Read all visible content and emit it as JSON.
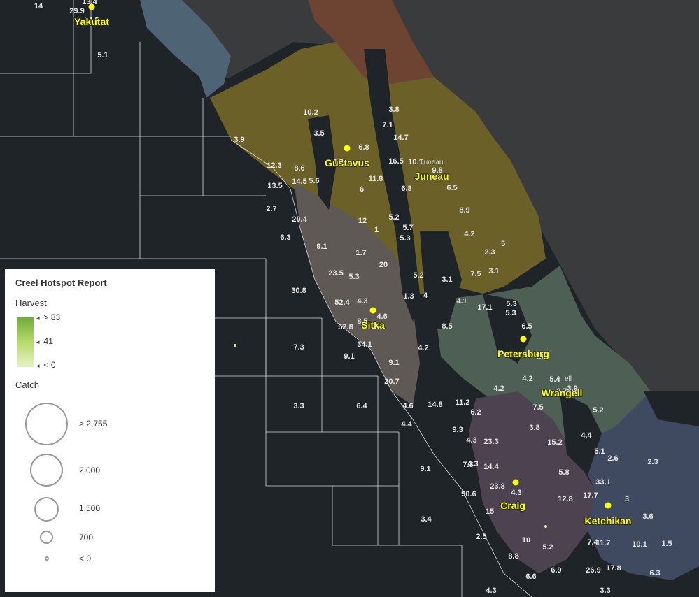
{
  "map": {
    "cities": [
      {
        "name": "Yakutat"
      },
      {
        "name": "Gustavus"
      },
      {
        "name": "Juneau"
      },
      {
        "name": "Sitka"
      },
      {
        "name": "Petersburg"
      },
      {
        "name": "Wrangell"
      },
      {
        "name": "Craig"
      },
      {
        "name": "Ketchikan"
      }
    ],
    "small_labels": [
      "Juneau",
      "ell"
    ],
    "area_values": [
      "14",
      "13.4",
      "29.9",
      "14.9",
      "5.1",
      "10.2",
      "3.5",
      "6.8",
      "14.3",
      "3.9",
      "12.3",
      "8.6",
      "13.5",
      "14.5",
      "5.6",
      "2.7",
      "20.4",
      "6.3",
      "9.1",
      "1.7",
      "23.5",
      "5.3",
      "30.8",
      "52.4",
      "4.3",
      "4.6",
      "8.5",
      "52.8",
      "34.1",
      "9.1",
      "9.1",
      "20.7",
      "7.3",
      "3.3",
      "6.4",
      "4.6",
      "4.4",
      "9.1",
      "3.4",
      "3.8",
      "7.1",
      "14.7",
      "16.5",
      "10.1",
      "9.8",
      "11.8",
      "6.8",
      "6.5",
      "6",
      "12",
      "5.2",
      "5.7",
      "1",
      "5.3",
      "8.9",
      "4.2",
      "20",
      "2.3",
      "5",
      "5.2",
      "3.1",
      "7.5",
      "1.3",
      "4",
      "3.1",
      "4.1",
      "17.1",
      "5.3",
      "5.3",
      "8.5",
      "6.5",
      "4.6",
      "4.2",
      "4.2",
      "4.2",
      "5.4",
      "2.7",
      "3.9",
      "7.5",
      "4.3",
      "14.8",
      "11.2",
      "6.2",
      "9.3",
      "3.8",
      "5.2",
      "4.4",
      "4.3",
      "23.3",
      "15.2",
      "5.1",
      "2.6",
      "2.3",
      "7.3",
      "14.4",
      "5.8",
      "33.1",
      "23.8",
      "4.3",
      "90.6",
      "12.8",
      "17.7",
      "3",
      "3.6",
      "15",
      "10",
      "5.2",
      "7.4",
      "11.7",
      "10.1",
      "1.5",
      "2.5",
      "8.8",
      "6.9",
      "26.9",
      "17.8",
      "6.3",
      "6.6",
      "4.3",
      "3.3"
    ]
  },
  "legend": {
    "title": "Creel Hotspot Report",
    "harvest": {
      "label": "Harvest",
      "ticks": [
        "> 83",
        "41",
        "< 0"
      ],
      "colors": [
        "#6fa83a",
        "#b6d96b",
        "#e5f3c4"
      ]
    },
    "catch": {
      "label": "Catch",
      "classes": [
        "> 2,755",
        "2,000",
        "1,500",
        "700",
        "< 0"
      ]
    }
  },
  "colors": {
    "background": "#1f2428",
    "land": "#3a3b3c",
    "yakutat_region": "#4e6474",
    "north_region": "#6d4432",
    "juneau_region": "#6b6027",
    "sitka_region": "#5e5954",
    "wrangell_region": "#4e5f55",
    "craig_region": "#4d4350",
    "ketchikan_region": "#3f4a60",
    "city_label": "#ffff00"
  }
}
